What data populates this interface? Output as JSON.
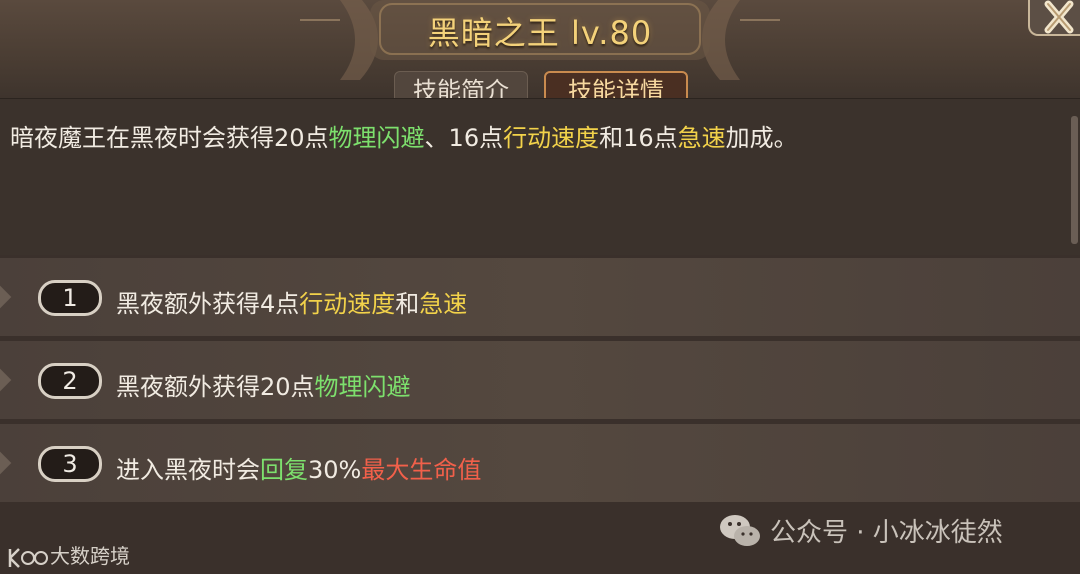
{
  "header": {
    "title": "黑暗之王 lv.80",
    "title_color": "#f4d27a"
  },
  "tabs": [
    {
      "label": "技能简介",
      "active": false
    },
    {
      "label": "技能详情",
      "active": true
    }
  ],
  "description": {
    "parts": [
      "暗夜魔王在黑夜时会获得20点",
      "物理闪避",
      "、16点",
      "行动速度",
      "和16点",
      "急速",
      "加成。"
    ]
  },
  "details": [
    {
      "number": "1",
      "parts": [
        "黑夜额外获得4点",
        "行动速度",
        "和",
        "急速"
      ]
    },
    {
      "number": "2",
      "parts": [
        "黑夜额外获得20点",
        "物理闪避"
      ]
    },
    {
      "number": "3",
      "parts": [
        "进入黑夜时会",
        "回复",
        "30%",
        "最大生命值"
      ]
    }
  ],
  "colors": {
    "highlight_green": "#7de06d",
    "highlight_gold": "#f2d24a",
    "highlight_red": "#f2604a",
    "tab_active_border": "#c98b4f"
  },
  "watermark": {
    "text": "公众号 · 小冰冰徒然",
    "icon": "wechat-icon"
  },
  "corner_logo": {
    "text": "大数跨境"
  }
}
